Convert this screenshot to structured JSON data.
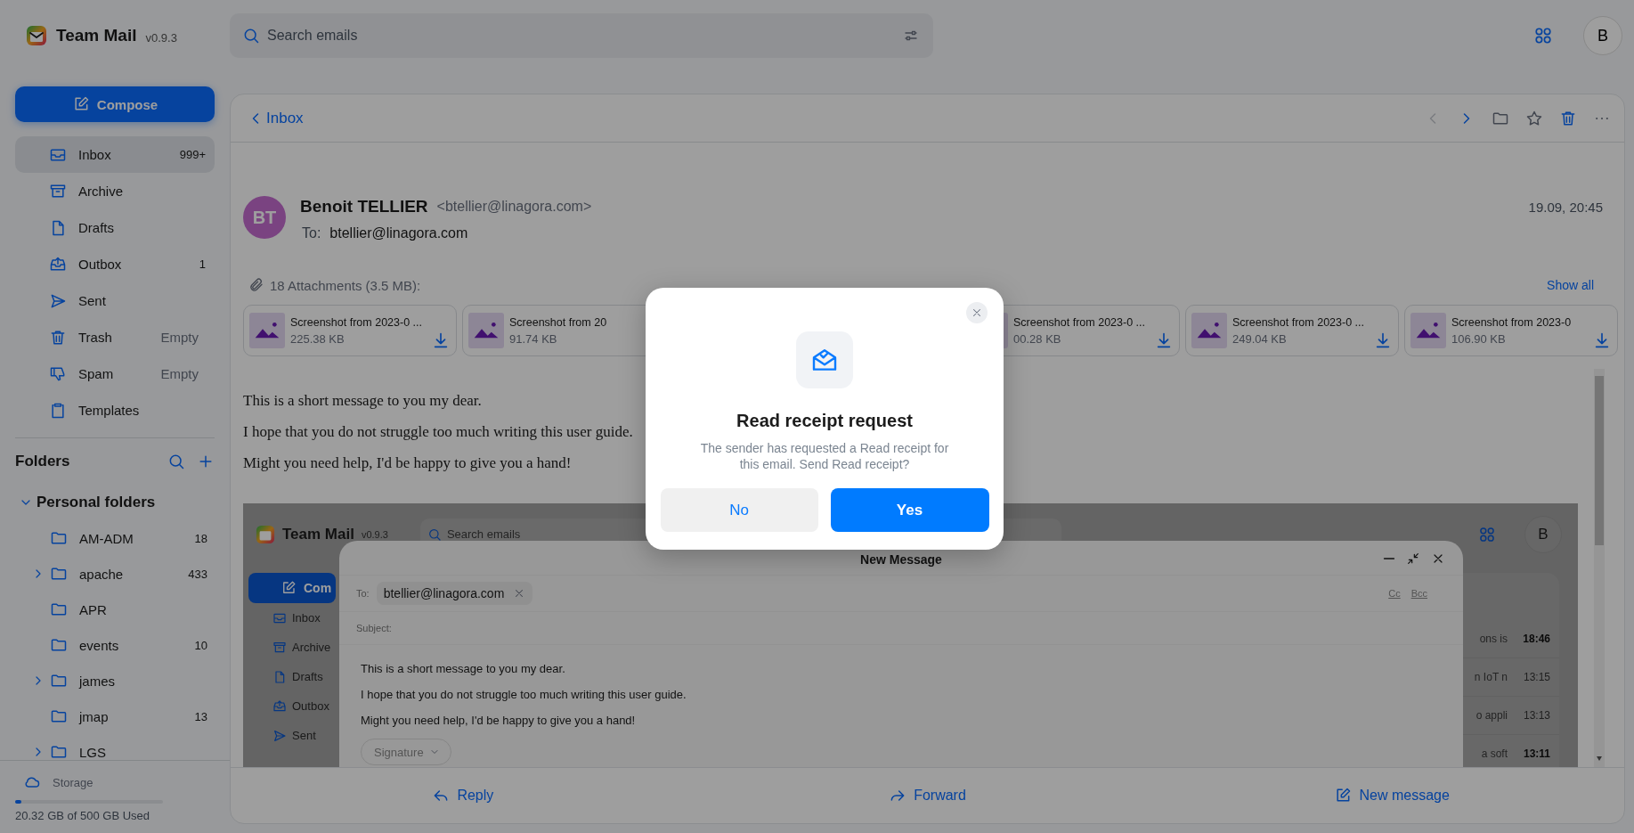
{
  "app": {
    "name": "Team Mail",
    "version": "v0.9.3"
  },
  "search": {
    "placeholder": "Search emails"
  },
  "account": {
    "initial": "B"
  },
  "compose": "Compose",
  "mailboxes": [
    {
      "kind": "inbox",
      "label": "Inbox",
      "count": "999+",
      "selected": true
    },
    {
      "kind": "archive",
      "label": "Archive",
      "selected": false
    },
    {
      "kind": "drafts",
      "label": "Drafts",
      "selected": false
    },
    {
      "kind": "outbox",
      "label": "Outbox",
      "count": "1",
      "selected": false
    },
    {
      "kind": "sent",
      "label": "Sent",
      "selected": false
    },
    {
      "kind": "trash",
      "label": "Trash",
      "action": "Empty",
      "selected": false
    },
    {
      "kind": "spam",
      "label": "Spam",
      "action": "Empty",
      "selected": false
    },
    {
      "kind": "templates",
      "label": "Templates",
      "selected": false
    }
  ],
  "folders": {
    "title": "Folders",
    "group": {
      "label": "Personal folders",
      "expanded": true,
      "children": [
        {
          "label": "AM-ADM",
          "count": "18",
          "has_children": false
        },
        {
          "label": "apache",
          "count": "433",
          "has_children": true
        },
        {
          "label": "APR",
          "has_children": false
        },
        {
          "label": "events",
          "count": "10",
          "has_children": false
        },
        {
          "label": "james",
          "has_children": true
        },
        {
          "label": "jmap",
          "count": "13",
          "has_children": false
        },
        {
          "label": "LGS",
          "has_children": true
        }
      ]
    }
  },
  "storage": {
    "label": "Storage",
    "level": 0.04,
    "usage": "20.32 GB of 500 GB Used"
  },
  "message": {
    "back": "Inbox",
    "toolbar": [
      {
        "kind": "previous",
        "disabled": true
      },
      {
        "kind": "next",
        "disabled": false
      },
      {
        "kind": "move",
        "disabled": false
      },
      {
        "kind": "star",
        "disabled": false
      },
      {
        "kind": "delete",
        "disabled": false
      },
      {
        "kind": "more",
        "disabled": false
      }
    ],
    "sender": {
      "initials": "BT",
      "name": "Benoit TELLIER",
      "address": "<btellier@linagora.com>"
    },
    "to_label": "To:",
    "to": "btellier@linagora.com",
    "date": "19.09, 20:45",
    "attachments_label": "18 Attachments (3.5 MB):",
    "show_all": "Show all",
    "attachments": [
      {
        "name": "Screenshot from 2023-0 ...",
        "size": "225.38 KB"
      },
      {
        "name": "Screenshot from 20",
        "size": "91.74 KB"
      },
      {
        "name": "Screenshot from 2023-0 ...",
        "size": "00.28 KB"
      },
      {
        "name": "Screenshot from 2023-0 ...",
        "size": "249.04 KB"
      },
      {
        "name": "Screenshot from 2023-0",
        "size": "106.90 KB"
      }
    ],
    "body": [
      "This is a short message to you my dear.",
      "I hope that you do not struggle too much writing this user guide.",
      "Might you need help, I'd be happy to give you a hand!"
    ],
    "embedded_screenshot": {
      "app_name": "Team Mail",
      "version": "v0.9.3",
      "search_placeholder": "Search emails",
      "avatar": "B",
      "compose": "Com",
      "nav": [
        {
          "kind": "inbox",
          "label": "Inbox"
        },
        {
          "kind": "archive",
          "label": "Archive"
        },
        {
          "kind": "drafts",
          "label": "Drafts"
        },
        {
          "kind": "outbox",
          "label": "Outbox"
        },
        {
          "kind": "sent",
          "label": "Sent"
        }
      ],
      "list_rows": [
        {
          "snippet": "ons is",
          "time": "18:46",
          "unread": true
        },
        {
          "snippet": "n IoT n",
          "time": "13:15",
          "unread": false
        },
        {
          "snippet": "o appli",
          "time": "13:13",
          "unread": false
        },
        {
          "snippet": "a soft",
          "time": "13:11",
          "unread": true
        }
      ],
      "composer": {
        "title": "New Message",
        "to_label": "To:",
        "recipient": "btellier@linagora.com",
        "cc": "Cc",
        "bcc": "Bcc",
        "subject_label": "Subject:",
        "body": [
          "This is a short message to you my dear.",
          "I hope that you do not struggle too much writing this user guide.",
          "Might you need help, I'd be happy to give you a hand!"
        ],
        "signature": "Signature"
      }
    },
    "actions": [
      {
        "kind": "reply",
        "label": "Reply"
      },
      {
        "kind": "forward",
        "label": "Forward"
      },
      {
        "kind": "new",
        "label": "New message"
      }
    ]
  },
  "dialog": {
    "title": "Read receipt request",
    "text": "The sender has requested a Read receipt for this email. Send Read receipt?",
    "buttons": [
      {
        "label": "No",
        "primary": false
      },
      {
        "label": "Yes",
        "primary": true
      }
    ]
  }
}
